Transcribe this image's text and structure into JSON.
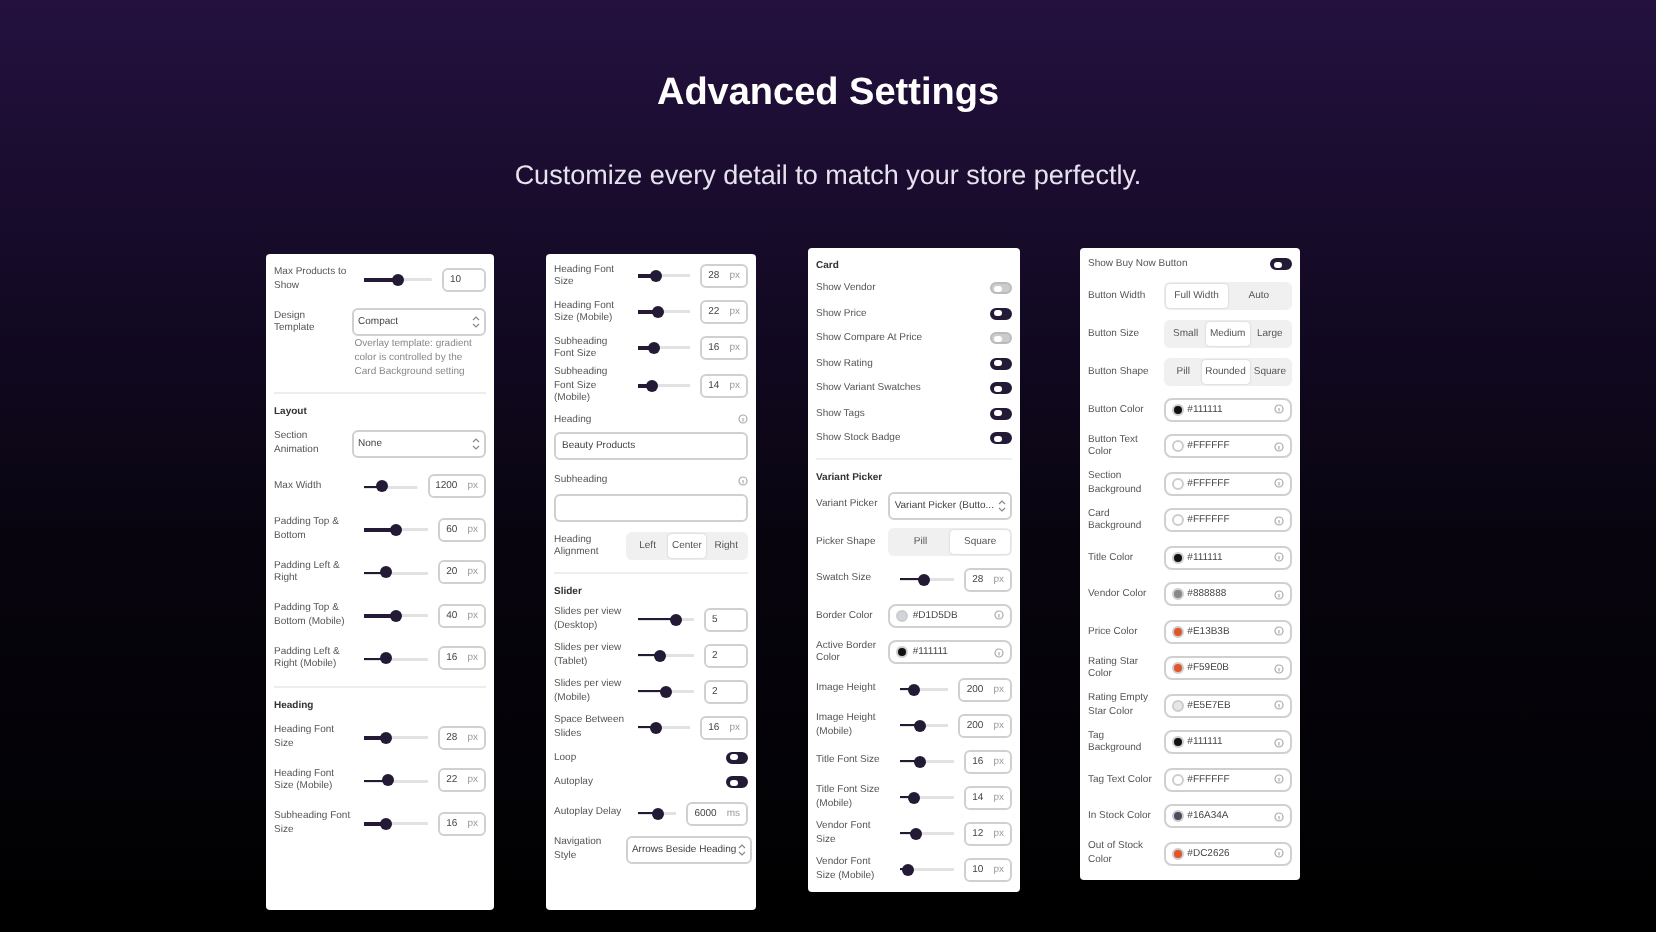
{
  "header": {
    "title": "Advanced Settings",
    "subtitle": "Customize every detail to match your store perfectly."
  },
  "panels": [
    {
      "items": [
        {
          "kind": "slider",
          "label": "Max Products to Show",
          "level": 0.5,
          "value": "10"
        },
        {
          "kind": "select",
          "label": "Design Template",
          "value": "Compact"
        },
        {
          "kind": "note",
          "text": "Overlay template: gradient color is controlled by the Card Background setting"
        },
        {
          "kind": "section",
          "label": "Layout"
        },
        {
          "kind": "select",
          "label": "Section Animation",
          "value": "None"
        },
        {
          "kind": "slider",
          "label": "Max Width",
          "level": 0.3,
          "value": "1200",
          "unit": "px"
        },
        {
          "kind": "slider",
          "label": "Padding Top & Bottom",
          "level": 0.5,
          "value": "60",
          "unit": "px"
        },
        {
          "kind": "slider",
          "label": "Padding Left & Right",
          "level": 0.3,
          "value": "20",
          "unit": "px"
        },
        {
          "kind": "slider",
          "label": "Padding Top & Bottom (Mobile)",
          "level": 0.5,
          "value": "40",
          "unit": "px"
        },
        {
          "kind": "slider",
          "label": "Padding Left & Right (Mobile)",
          "level": 0.3,
          "value": "16",
          "unit": "px"
        },
        {
          "kind": "section",
          "label": "Heading"
        },
        {
          "kind": "slider",
          "label": "Heading Font Size",
          "level": 0.3,
          "value": "28",
          "unit": "px"
        },
        {
          "kind": "slider",
          "label": "Heading Font Size (Mobile)",
          "level": 0.35,
          "value": "22",
          "unit": "px"
        },
        {
          "kind": "slider",
          "label": "Subheading Font Size",
          "level": 0.3,
          "value": "16",
          "unit": "px"
        }
      ]
    },
    {
      "items": [
        {
          "kind": "slider",
          "label": "Heading Font Size",
          "level": 0.3,
          "value": "28",
          "unit": "px"
        },
        {
          "kind": "slider",
          "label": "Heading Font Size (Mobile)",
          "level": 0.35,
          "value": "22",
          "unit": "px"
        },
        {
          "kind": "slider",
          "label": "Subheading Font Size",
          "level": 0.25,
          "value": "16",
          "unit": "px"
        },
        {
          "kind": "slider",
          "label": "Subheading Font Size (Mobile)",
          "level": 0.2,
          "value": "14",
          "unit": "px"
        },
        {
          "kind": "text",
          "label": "Heading",
          "value": "Beauty Products"
        },
        {
          "kind": "text",
          "label": "Subheading"
        },
        {
          "kind": "segmented",
          "label": "Heading Alignment",
          "options": [
            {
              "label": "Left",
              "selected": false
            },
            {
              "label": "Center",
              "selected": true
            },
            {
              "label": "Right",
              "selected": false
            }
          ]
        },
        {
          "kind": "section",
          "label": "Slider"
        },
        {
          "kind": "slider",
          "label": "Slides per view (Desktop)",
          "level": 0.75,
          "value": "5"
        },
        {
          "kind": "slider",
          "label": "Slides per view (Tablet)",
          "level": 0.35,
          "value": "2"
        },
        {
          "kind": "slider",
          "label": "Slides per view (Mobile)",
          "level": 0.5,
          "value": "2"
        },
        {
          "kind": "slider",
          "label": "Space Between Slides",
          "level": 0.3,
          "value": "16",
          "unit": "px"
        },
        {
          "kind": "toggle",
          "label": "Loop",
          "on": true
        },
        {
          "kind": "toggle",
          "label": "Autoplay",
          "on": true
        },
        {
          "kind": "slider",
          "label": "Autoplay Delay",
          "level": 0.55,
          "value": "6000",
          "unit": "ms"
        },
        {
          "kind": "select",
          "label": "Navigation Style",
          "value": "Arrows Beside Heading"
        }
      ]
    },
    {
      "items": [
        {
          "kind": "section",
          "label": "Card"
        },
        {
          "kind": "toggle",
          "label": "Show Vendor",
          "on": false
        },
        {
          "kind": "toggle",
          "label": "Show Price",
          "on": true
        },
        {
          "kind": "toggle",
          "label": "Show Compare At Price",
          "on": false
        },
        {
          "kind": "toggle",
          "label": "Show Rating",
          "on": true
        },
        {
          "kind": "toggle",
          "label": "Show Variant Swatches",
          "on": true
        },
        {
          "kind": "toggle",
          "label": "Show Tags",
          "on": true
        },
        {
          "kind": "toggle",
          "label": "Show Stock Badge",
          "on": true
        },
        {
          "kind": "section",
          "label": "Variant Picker"
        },
        {
          "kind": "select",
          "label": "Variant Picker",
          "value": "Variant Picker (Butto..."
        },
        {
          "kind": "segmented",
          "label": "Picker Shape",
          "options": [
            {
              "label": "Pill",
              "selected": false
            },
            {
              "label": "Square",
              "selected": true
            }
          ]
        },
        {
          "kind": "slider",
          "label": "Swatch Size",
          "level": 0.4,
          "value": "28",
          "unit": "px"
        },
        {
          "kind": "color",
          "label": "Border Color",
          "color": "#d1d5db",
          "value": "#D1D5DB"
        },
        {
          "kind": "color",
          "label": "Active Border Color",
          "color": "#111111",
          "value": "#111111"
        },
        {
          "kind": "slider",
          "label": "Image Height",
          "level": 0.2,
          "value": "200",
          "unit": "px"
        },
        {
          "kind": "slider",
          "label": "Image Height (Mobile)",
          "level": 0.35,
          "value": "200",
          "unit": "px"
        },
        {
          "kind": "slider",
          "label": "Title Font Size",
          "level": 0.3,
          "value": "16",
          "unit": "px"
        },
        {
          "kind": "slider",
          "label": "Title Font Size (Mobile)",
          "level": 0.2,
          "value": "14",
          "unit": "px"
        },
        {
          "kind": "slider",
          "label": "Vendor Font Size",
          "level": 0.25,
          "value": "12",
          "unit": "px"
        },
        {
          "kind": "slider",
          "label": "Vendor Font Size (Mobile)",
          "level": 0.05,
          "value": "10",
          "unit": "px"
        }
      ]
    },
    {
      "items": [
        {
          "kind": "toggle",
          "label": "Show Buy Now Button",
          "on": true
        },
        {
          "kind": "segmented",
          "label": "Button Width",
          "options": [
            {
              "label": "Full Width",
              "selected": true
            },
            {
              "label": "Auto",
              "selected": false
            }
          ]
        },
        {
          "kind": "segmented",
          "label": "Button Size",
          "options": [
            {
              "label": "Small",
              "selected": false
            },
            {
              "label": "Medium",
              "selected": true
            },
            {
              "label": "Large",
              "selected": false
            }
          ]
        },
        {
          "kind": "segmented",
          "label": "Button Shape",
          "options": [
            {
              "label": "Pill",
              "selected": false
            },
            {
              "label": "Rounded",
              "selected": true
            },
            {
              "label": "Square",
              "selected": false
            }
          ]
        },
        {
          "kind": "color",
          "label": "Button Color",
          "color": "#111111",
          "value": "#111111"
        },
        {
          "kind": "color",
          "label": "Button Text Color",
          "color": "#ffffff",
          "value": "#FFFFFF"
        },
        {
          "kind": "color",
          "label": "Section Background",
          "color": "#ffffff",
          "value": "#FFFFFF"
        },
        {
          "kind": "color",
          "label": "Card Background",
          "color": "#ffffff",
          "value": "#FFFFFF"
        },
        {
          "kind": "color",
          "label": "Title Color",
          "color": "#111111",
          "value": "#111111"
        },
        {
          "kind": "color",
          "label": "Vendor Color",
          "color": "#888888",
          "value": "#888888"
        },
        {
          "kind": "color",
          "label": "Price Color",
          "color": "#e0562b",
          "value": "#E13B3B"
        },
        {
          "kind": "color",
          "label": "Rating Star Color",
          "color": "#e0562b",
          "value": "#F59E0B"
        },
        {
          "kind": "color",
          "label": "Rating Empty Star Color",
          "color": "#e5e7eb",
          "value": "#E5E7EB"
        },
        {
          "kind": "color",
          "label": "Tag Background",
          "color": "#111111",
          "value": "#111111"
        },
        {
          "kind": "color",
          "label": "Tag Text Color",
          "color": "#ffffff",
          "value": "#FFFFFF"
        },
        {
          "kind": "color",
          "label": "In Stock Color",
          "color": "#4f4a5c",
          "value": "#16A34A"
        },
        {
          "kind": "color",
          "label": "Out of Stock Color",
          "color": "#e0562b",
          "value": "#DC2626"
        }
      ]
    }
  ]
}
